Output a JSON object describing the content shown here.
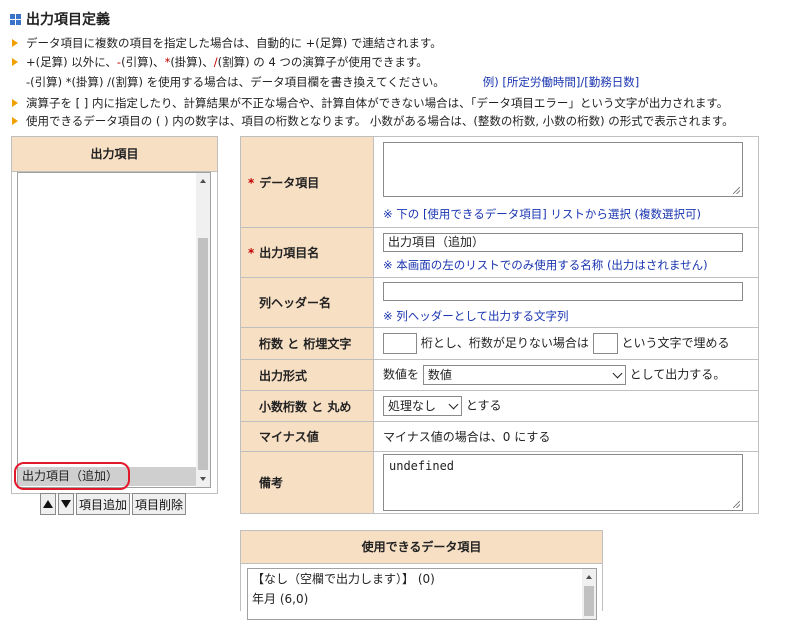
{
  "page": {
    "title": "出力項目定義"
  },
  "notes": {
    "line1": "データ項目に複数の項目を指定した場合は、自動的に +(足算) で連結されます。",
    "line2_a": "+(足算) 以外に、",
    "line2_op1": "-",
    "line2_b": "(引算)、",
    "line2_op2": "*",
    "line2_c": "(掛算)、",
    "line2_op3": "/",
    "line2_d": "(割算) の 4 つの演算子が使用できます。",
    "line3": "-(引算) *(掛算) /(割算) を使用する場合は、データ項目欄を書き換えてください。",
    "line3_example": "例) [所定労働時間]/[勤務日数]",
    "line4": "演算子を [ ] 内に指定したり、計算結果が不正な場合や、計算自体ができない場合は、「データ項目エラー」という文字が出力されます。",
    "line5": "使用できるデータ項目の ( ) 内の数字は、項目の桁数となります。 小数がある場合は、(整数の桁数, 小数の桁数) の形式で表示されます。"
  },
  "left_panel": {
    "header": "出力項目",
    "items": [
      "出力項目（追加）"
    ],
    "add_button": "項目追加",
    "delete_button": "項目削除"
  },
  "form": {
    "data_item": {
      "label": "データ項目",
      "required_mark": "*",
      "value": "",
      "hint": "※ 下の [使用できるデータ項目] リストから選択 (複数選択可)"
    },
    "output_name": {
      "label": "出力項目名",
      "required_mark": "*",
      "value": "出力項目（追加）",
      "hint": "※ 本画面の左のリストでのみ使用する名称 (出力はされません)"
    },
    "column_header": {
      "label": "列ヘッダー名",
      "value": "",
      "hint": "※ 列ヘッダーとして出力する文字列"
    },
    "digits": {
      "label": "桁数 と 桁埋文字",
      "text1": "桁とし、桁数が足りない場合は",
      "text2": "という文字で埋める",
      "digits_value": "",
      "fill_value": ""
    },
    "format": {
      "label": "出力形式",
      "prefix": "数値を",
      "selected": "数値",
      "suffix": "として出力する。"
    },
    "decimal": {
      "label": "小数桁数 と 丸め",
      "selected": "処理なし",
      "suffix": "とする"
    },
    "negative": {
      "label": "マイナス値",
      "text": "マイナス値の場合は、0 にする"
    },
    "remarks": {
      "label": "備考",
      "value": "undefined"
    }
  },
  "available": {
    "header": "使用できるデータ項目",
    "items": [
      "【なし（空欄で出力します）】 (0)",
      "年月 (6,0)"
    ]
  },
  "colors": {
    "header_bg": "#f7dfc4",
    "hint_blue": "#1a35b0",
    "required_red": "#c00000",
    "bullet_orange": "#f0a000",
    "highlight_red": "#e2182b"
  }
}
